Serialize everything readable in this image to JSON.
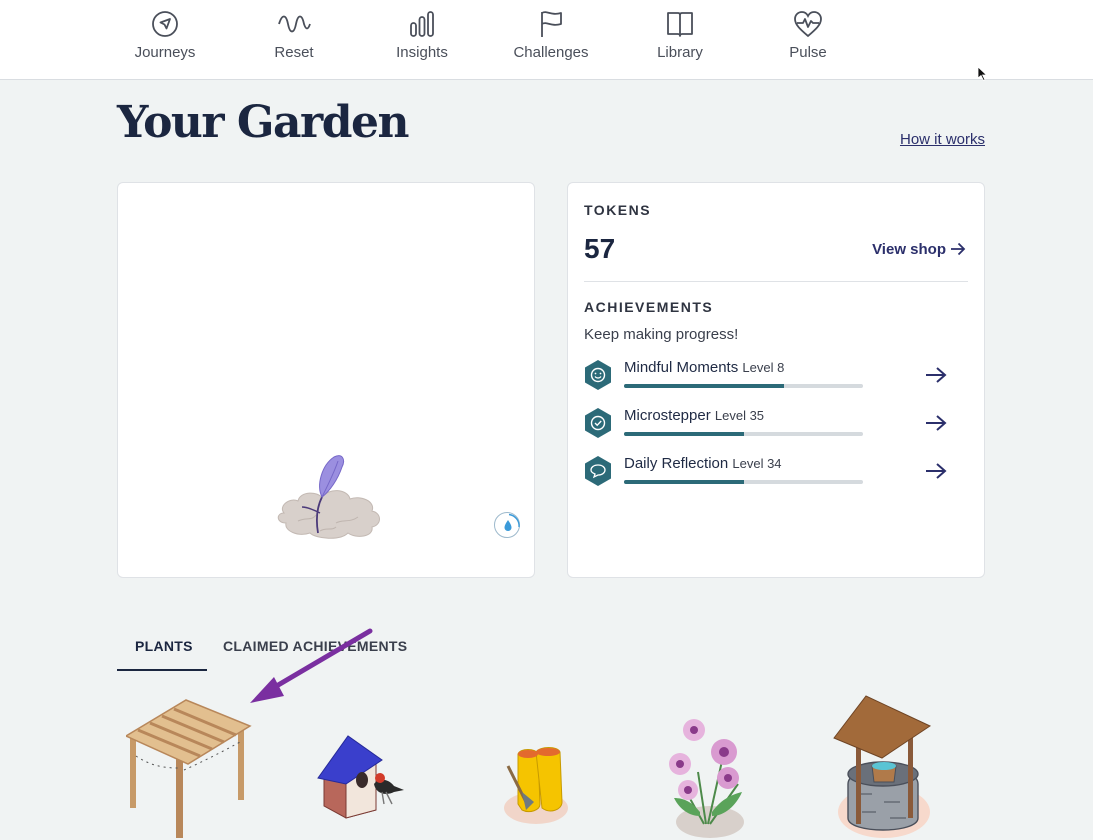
{
  "nav": {
    "items": [
      {
        "label": "Journeys",
        "icon": "compass-icon"
      },
      {
        "label": "Reset",
        "icon": "wave-icon"
      },
      {
        "label": "Insights",
        "icon": "bar-chart-icon"
      },
      {
        "label": "Challenges",
        "icon": "flag-icon"
      },
      {
        "label": "Library",
        "icon": "book-icon"
      },
      {
        "label": "Pulse",
        "icon": "heart-pulse-icon"
      }
    ]
  },
  "page": {
    "title": "Your Garden",
    "how_it_works": "How it works"
  },
  "tokens": {
    "heading": "TOKENS",
    "count": "57",
    "view_shop": "View shop"
  },
  "achievements": {
    "heading": "ACHIEVEMENTS",
    "message": "Keep making progress!",
    "items": [
      {
        "name": "Mindful Moments",
        "level": "Level 8",
        "progress": 0.67,
        "icon": "smile-icon"
      },
      {
        "name": "Microstepper",
        "level": "Level 35",
        "progress": 0.5,
        "icon": "check-circle-icon"
      },
      {
        "name": "Daily Reflection",
        "level": "Level 34",
        "progress": 0.5,
        "icon": "chat-bubble-icon"
      }
    ]
  },
  "tabs": {
    "plants": "PLANTS",
    "claimed": "CLAIMED ACHIEVEMENTS"
  },
  "colors": {
    "accent": "#2b2f6b",
    "badge": "#2c6a78",
    "progress_track": "#d5dade",
    "annotation_arrow": "#7a2fa0"
  },
  "garden_items": [
    {
      "icon": "pergola-icon"
    },
    {
      "icon": "birdhouse-icon"
    },
    {
      "icon": "rain-boots-icon"
    },
    {
      "icon": "daisy-plant-icon"
    },
    {
      "icon": "wishing-well-icon"
    }
  ]
}
